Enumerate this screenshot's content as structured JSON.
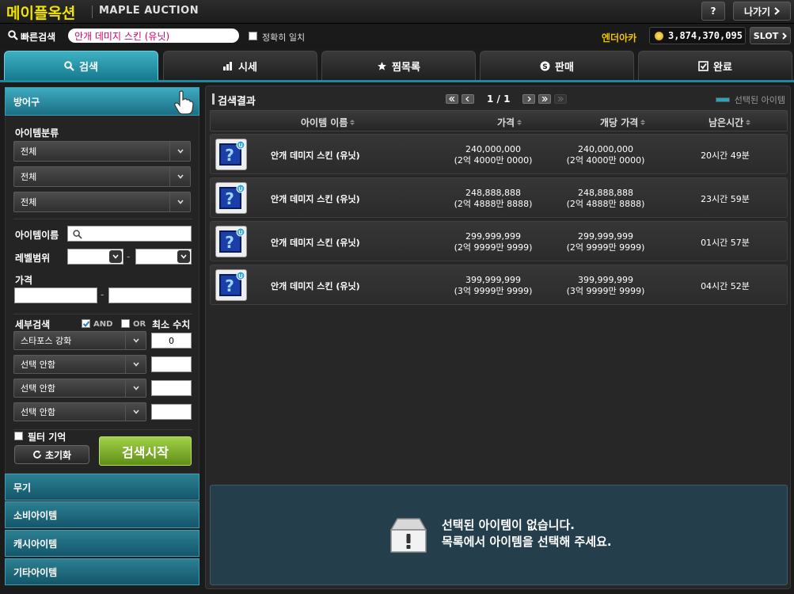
{
  "header": {
    "brand_ko": "메이플옥션",
    "brand_en": "MAPLE AUCTION",
    "help_label": "?",
    "exit_label": "나가기"
  },
  "quick_search": {
    "label": "빠른검색",
    "value": "안개 데미지 스킨 (유닛)",
    "exact_label": "정확히 일치",
    "server": "엔더아카",
    "mesos": "3,874,370,095",
    "slot_label": "SLOT"
  },
  "tabs": [
    {
      "label": "검색",
      "icon": "search-icon",
      "active": true
    },
    {
      "label": "시세",
      "icon": "chart-icon",
      "active": false
    },
    {
      "label": "찜목록",
      "icon": "star-icon",
      "active": false
    },
    {
      "label": "판매",
      "icon": "coin-icon",
      "active": false
    },
    {
      "label": "완료",
      "icon": "check-icon",
      "active": false
    }
  ],
  "sidebar": {
    "active_category": "방어구",
    "item_class_label": "아이템분류",
    "class_selects": [
      "전체",
      "전체",
      "전체"
    ],
    "item_name_label": "아이템이름",
    "level_label": "레벨범위",
    "level_dash": "-",
    "price_label": "가격",
    "price_dash": "-",
    "detail_label": "세부검색",
    "and_label": "AND",
    "or_label": "OR",
    "min_label": "최소 수치",
    "detail_rows": [
      {
        "option": "스타포스 강화",
        "value": "0"
      },
      {
        "option": "선택 안함",
        "value": ""
      },
      {
        "option": "선택 안함",
        "value": ""
      },
      {
        "option": "선택 안함",
        "value": ""
      }
    ],
    "remember_label": "필터 기억",
    "reset_label": "초기화",
    "search_label": "검색시작",
    "other_categories": [
      "무기",
      "소비아이템",
      "캐시아이템",
      "기타아이템"
    ]
  },
  "results": {
    "title": "검색결과",
    "page_text": "1 / 1",
    "legend": "선택된 아이템",
    "columns": [
      "아이템 이름",
      "가격",
      "개당 가격",
      "남은시간"
    ],
    "rows": [
      {
        "name": "안개 데미지 스킨 (유닛)",
        "price": "240,000,000",
        "price_ko": "(2억 4000만 0000)",
        "unit": "240,000,000",
        "unit_ko": "(2억 4000만 0000)",
        "remain": "20시간 49분"
      },
      {
        "name": "안개 데미지 스킨 (유닛)",
        "price": "248,888,888",
        "price_ko": "(2억 4888만 8888)",
        "unit": "248,888,888",
        "unit_ko": "(2억 4888만 8888)",
        "remain": "23시간 59분"
      },
      {
        "name": "안개 데미지 스킨 (유닛)",
        "price": "299,999,999",
        "price_ko": "(2억 9999만 9999)",
        "unit": "299,999,999",
        "unit_ko": "(2억 9999만 9999)",
        "remain": "01시간 57분"
      },
      {
        "name": "안개 데미지 스킨 (유닛)",
        "price": "399,999,999",
        "price_ko": "(3억 9999만 9999)",
        "unit": "399,999,999",
        "unit_ko": "(3억 9999만 9999)",
        "remain": "04시간 52분"
      }
    ],
    "empty_line1": "선택된 아이템이 없습니다.",
    "empty_line2": "목록에서 아이템을 선택해 주세요."
  },
  "colors": {
    "brand": "#f2e300",
    "accent": "#22889b",
    "search_button": "#7fb52e",
    "query_text": "#d2006c"
  }
}
